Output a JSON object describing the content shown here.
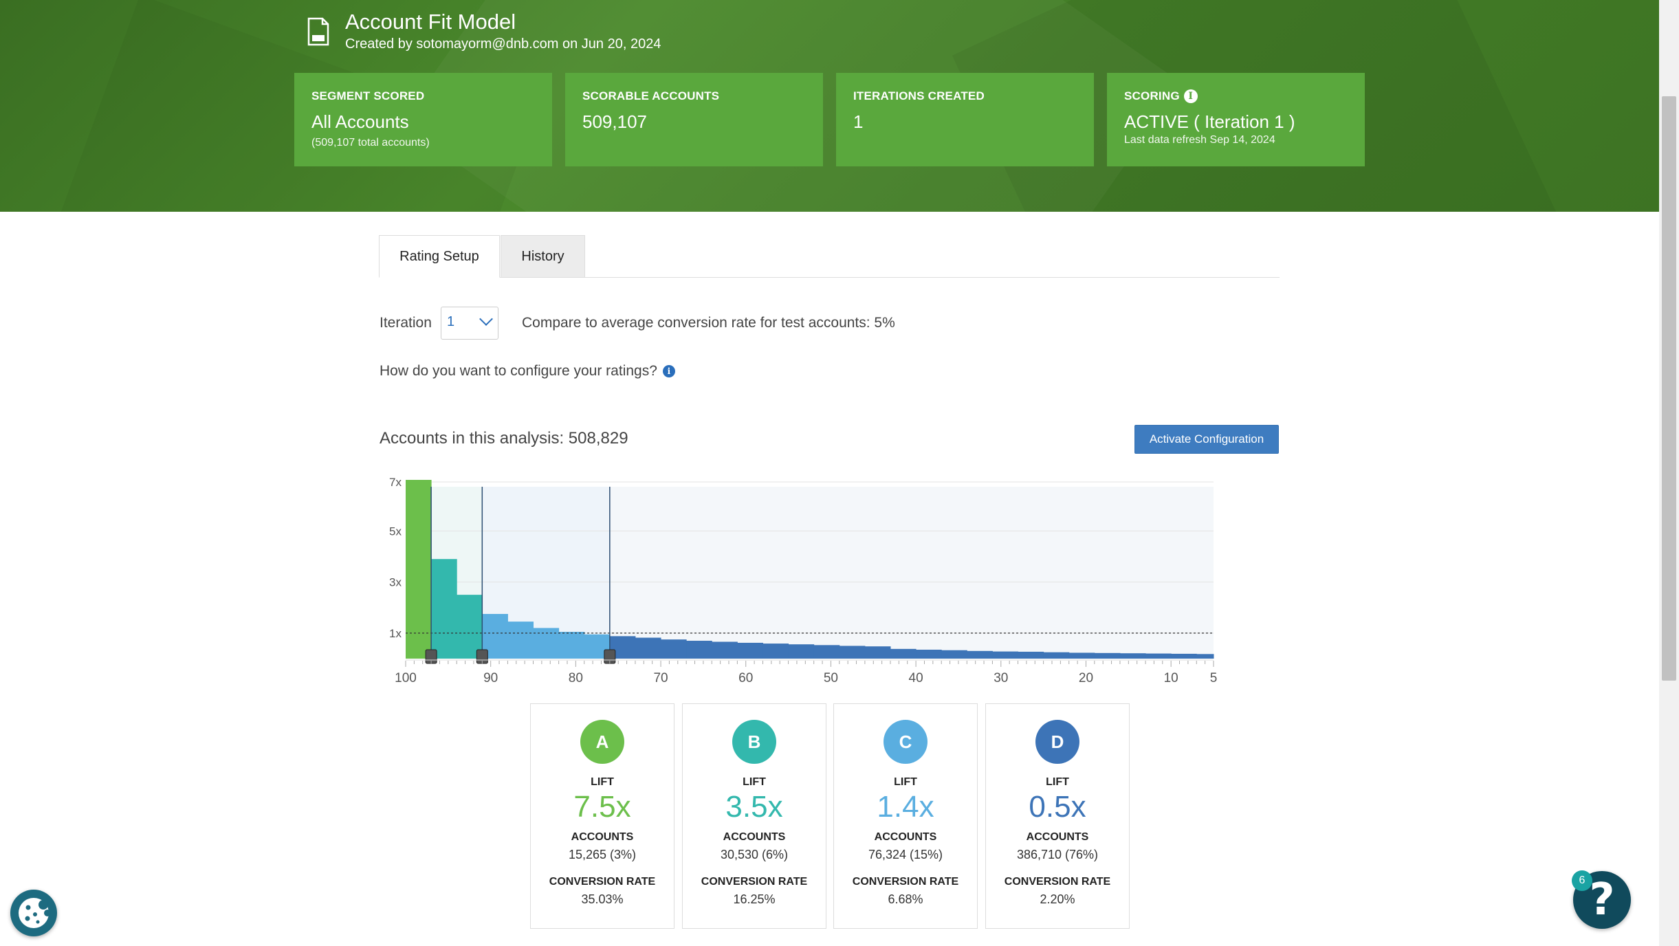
{
  "model": {
    "title": "Account Fit Model",
    "created": "Created by sotomayorm@dnb.com on Jun 20, 2024"
  },
  "stats": {
    "segment": {
      "label": "SEGMENT SCORED",
      "value": "All Accounts",
      "sub": "(509,107 total accounts)"
    },
    "scorable": {
      "label": "SCORABLE ACCOUNTS",
      "value": "509,107"
    },
    "iterations": {
      "label": "ITERATIONS CREATED",
      "value": "1"
    },
    "scoring": {
      "label": "SCORING",
      "value": "ACTIVE ( Iteration 1 )",
      "sub": "Last data refresh Sep 14, 2024"
    }
  },
  "tabs": {
    "rating_setup": "Rating Setup",
    "history": "History"
  },
  "iteration": {
    "label": "Iteration",
    "selected": "1"
  },
  "compare_text": "Compare to average conversion rate for test accounts: 5%",
  "config_question": "How do you want to configure your ratings?",
  "analysis_text": "Accounts in this analysis: 508,829",
  "activate_label": "Activate Configuration",
  "colors": {
    "A": "#6cbf4b",
    "B": "#33b8ad",
    "C": "#5aaee0",
    "D": "#3d74b7",
    "header": "#447f27",
    "tile": "#5aa83d",
    "button": "#3e7cc0"
  },
  "chart_data": {
    "type": "bar",
    "title": "",
    "xlabel": "",
    "ylabel": "",
    "x_ticks": [
      "100",
      "90",
      "80",
      "70",
      "60",
      "50",
      "40",
      "30",
      "20",
      "10",
      "5"
    ],
    "y_ticks": [
      "7x",
      "5x",
      "3x",
      "1x"
    ],
    "xlim": [
      100,
      5
    ],
    "ylim": [
      0,
      7
    ],
    "baseline_lift": 1,
    "cutoffs": [
      97,
      91,
      76
    ],
    "buckets": [
      {
        "from": 100,
        "to": 97,
        "lift": 7.0,
        "rating": "A"
      },
      {
        "from": 97,
        "to": 94,
        "lift": 3.9,
        "rating": "B"
      },
      {
        "from": 94,
        "to": 91,
        "lift": 2.5,
        "rating": "B"
      },
      {
        "from": 91,
        "to": 88,
        "lift": 1.75,
        "rating": "C"
      },
      {
        "from": 88,
        "to": 85,
        "lift": 1.45,
        "rating": "C"
      },
      {
        "from": 85,
        "to": 82,
        "lift": 1.2,
        "rating": "C"
      },
      {
        "from": 82,
        "to": 79,
        "lift": 1.05,
        "rating": "C"
      },
      {
        "from": 79,
        "to": 76,
        "lift": 0.95,
        "rating": "C"
      },
      {
        "from": 76,
        "to": 73,
        "lift": 0.88,
        "rating": "D"
      },
      {
        "from": 73,
        "to": 70,
        "lift": 0.82,
        "rating": "D"
      },
      {
        "from": 70,
        "to": 67,
        "lift": 0.75,
        "rating": "D"
      },
      {
        "from": 67,
        "to": 64,
        "lift": 0.7,
        "rating": "D"
      },
      {
        "from": 64,
        "to": 61,
        "lift": 0.66,
        "rating": "D"
      },
      {
        "from": 61,
        "to": 58,
        "lift": 0.62,
        "rating": "D"
      },
      {
        "from": 58,
        "to": 55,
        "lift": 0.59,
        "rating": "D"
      },
      {
        "from": 55,
        "to": 52,
        "lift": 0.56,
        "rating": "D"
      },
      {
        "from": 52,
        "to": 49,
        "lift": 0.53,
        "rating": "D"
      },
      {
        "from": 49,
        "to": 46,
        "lift": 0.5,
        "rating": "D"
      },
      {
        "from": 46,
        "to": 43,
        "lift": 0.48,
        "rating": "D"
      },
      {
        "from": 43,
        "to": 40,
        "lift": 0.38,
        "rating": "D"
      },
      {
        "from": 40,
        "to": 37,
        "lift": 0.35,
        "rating": "D"
      },
      {
        "from": 37,
        "to": 34,
        "lift": 0.33,
        "rating": "D"
      },
      {
        "from": 34,
        "to": 31,
        "lift": 0.3,
        "rating": "D"
      },
      {
        "from": 31,
        "to": 28,
        "lift": 0.28,
        "rating": "D"
      },
      {
        "from": 28,
        "to": 25,
        "lift": 0.27,
        "rating": "D"
      },
      {
        "from": 25,
        "to": 22,
        "lift": 0.25,
        "rating": "D"
      },
      {
        "from": 22,
        "to": 19,
        "lift": 0.23,
        "rating": "D"
      },
      {
        "from": 19,
        "to": 16,
        "lift": 0.22,
        "rating": "D"
      },
      {
        "from": 16,
        "to": 13,
        "lift": 0.21,
        "rating": "D"
      },
      {
        "from": 13,
        "to": 10,
        "lift": 0.2,
        "rating": "D"
      },
      {
        "from": 10,
        "to": 7,
        "lift": 0.19,
        "rating": "D"
      },
      {
        "from": 7,
        "to": 5,
        "lift": 0.18,
        "rating": "D"
      }
    ]
  },
  "ratings": [
    {
      "letter": "A",
      "lift_label": "LIFT",
      "lift": "7.5x",
      "accounts_label": "ACCOUNTS",
      "accounts": "15,265 (3%)",
      "conv_label": "CONVERSION RATE",
      "conv": "35.03%"
    },
    {
      "letter": "B",
      "lift_label": "LIFT",
      "lift": "3.5x",
      "accounts_label": "ACCOUNTS",
      "accounts": "30,530 (6%)",
      "conv_label": "CONVERSION RATE",
      "conv": "16.25%"
    },
    {
      "letter": "C",
      "lift_label": "LIFT",
      "lift": "1.4x",
      "accounts_label": "ACCOUNTS",
      "accounts": "76,324 (15%)",
      "conv_label": "CONVERSION RATE",
      "conv": "6.68%"
    },
    {
      "letter": "D",
      "lift_label": "LIFT",
      "lift": "0.5x",
      "accounts_label": "ACCOUNTS",
      "accounts": "386,710 (76%)",
      "conv_label": "CONVERSION RATE",
      "conv": "2.20%"
    }
  ],
  "help_badge": "6",
  "help_icon": "question-icon",
  "cookie_icon": "cookie-icon"
}
